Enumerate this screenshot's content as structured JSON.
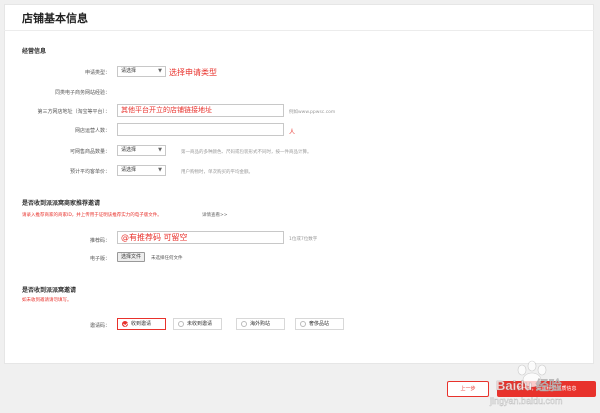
{
  "page": {
    "title": "店铺基本信息"
  },
  "operation": {
    "section_title": "经营信息",
    "apply_type_label": "申请类型：",
    "apply_type_value": "请选择",
    "apply_type_note": "选择申请类型",
    "experience_label": "同类电子商务网站经验：",
    "third_party_label": "第三方网店地址（淘宝等平台）：",
    "third_party_value": "其他平台开立的店铺链接地址",
    "third_party_hint": "例如www.ppwsc.com",
    "staff_label": "网店运营人数：",
    "staff_value": "",
    "staff_unit": "人",
    "goods_count_label": "可网售商品数量：",
    "goods_count_value": "请选择",
    "goods_count_hint": "第一商品的多种颜色、尺码或包装形式不同时，按一件商品计算。",
    "avg_price_label": "预计平均客单价：",
    "avg_price_value": "请选择",
    "avg_price_hint": "用户购物时，单次购买的平均金额。"
  },
  "recommend": {
    "section_title": "是否收到派派窝商家推荐邀请",
    "warning": "请录入推荐商家的商家ID，并上传用于证明该推荐实力的电子版文件。",
    "detail_link": "详情查看>>",
    "recommend_code_label": "推荐码：",
    "recommend_code_value": "@有推荐码 可留空",
    "recommend_code_hint": "1位或7位数字",
    "file_label": "电子版：",
    "file_button": "选择文件",
    "file_status": "未选择任何文件"
  },
  "invite": {
    "section_title": "是否收到派派窝邀请",
    "warning": "如未收到邀请请勿填写。",
    "label": "邀请码：",
    "options": [
      "收到邀请",
      "未收到邀请",
      "海外购站",
      "奢侈品站"
    ],
    "selected_index": 0
  },
  "footer": {
    "prev_button": "上一步",
    "next_button": "下一步，完善经营资质信息"
  },
  "watermark": {
    "brand": "Baidu 经验",
    "url": "jingyan.baidu.com"
  },
  "colors": {
    "accent": "#e8322c",
    "border": "#c8c8c8",
    "background": "#f0f0f0"
  },
  "icons": {
    "select_arrow": "chevron-down-icon",
    "radio_check": "check-icon"
  }
}
